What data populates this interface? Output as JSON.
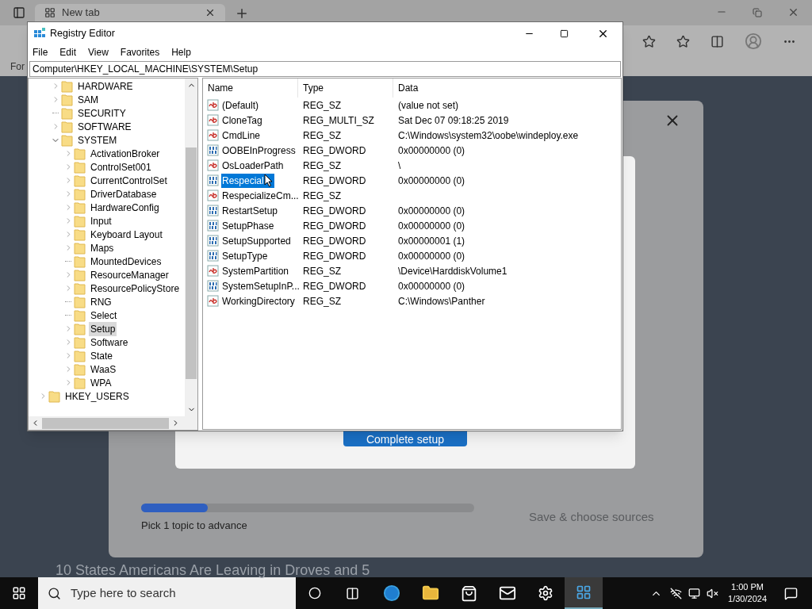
{
  "browser": {
    "tab_title": "New tab",
    "partial_text": "For"
  },
  "setup_dialog": {
    "complete_button": "Complete setup",
    "progress": {
      "level": 0.2
    },
    "hint": "Pick 1 topic to advance",
    "save_button": {
      "label": "Save & choose sources",
      "disabled": true
    }
  },
  "headline": "10 States Americans Are Leaving in Droves and 5",
  "registry": {
    "title": "Registry Editor",
    "menu": [
      "File",
      "Edit",
      "View",
      "Favorites",
      "Help"
    ],
    "address": "Computer\\HKEY_LOCAL_MACHINE\\SYSTEM\\Setup",
    "tree": [
      {
        "children": [
          {
            "kind": "collapsed",
            "name": "HARDWARE",
            "selected": false
          },
          {
            "kind": "collapsed",
            "name": "SAM",
            "selected": false
          },
          {
            "kind": "leaf",
            "name": "SECURITY",
            "selected": false
          },
          {
            "kind": "collapsed",
            "name": "SOFTWARE",
            "selected": false
          },
          {
            "kind": "expanded",
            "name": "SYSTEM",
            "selected": false,
            "children": [
              {
                "kind": "collapsed",
                "name": "ActivationBroker",
                "selected": false
              },
              {
                "kind": "collapsed",
                "name": "ControlSet001",
                "selected": false
              },
              {
                "kind": "collapsed",
                "name": "CurrentControlSet",
                "selected": false
              },
              {
                "kind": "collapsed",
                "name": "DriverDatabase",
                "selected": false
              },
              {
                "kind": "collapsed",
                "name": "HardwareConfig",
                "selected": false
              },
              {
                "kind": "collapsed",
                "name": "Input",
                "selected": false
              },
              {
                "kind": "collapsed",
                "name": "Keyboard Layout",
                "selected": false
              },
              {
                "kind": "collapsed",
                "name": "Maps",
                "selected": false
              },
              {
                "kind": "leaf",
                "name": "MountedDevices",
                "selected": false
              },
              {
                "kind": "collapsed",
                "name": "ResourceManager",
                "selected": false
              },
              {
                "kind": "collapsed",
                "name": "ResourcePolicyStore",
                "selected": false
              },
              {
                "kind": "leaf",
                "name": "RNG",
                "selected": false
              },
              {
                "kind": "leaf",
                "name": "Select",
                "selected": false
              },
              {
                "kind": "collapsed",
                "name": "Setup",
                "selected": true
              },
              {
                "kind": "collapsed",
                "name": "Software",
                "selected": false
              },
              {
                "kind": "collapsed",
                "name": "State",
                "selected": false
              },
              {
                "kind": "collapsed",
                "name": "WaaS",
                "selected": false
              },
              {
                "kind": "collapsed",
                "name": "WPA",
                "selected": false
              }
            ]
          }
        ]
      },
      {
        "kind": "collapsed",
        "name": "HKEY_USERS",
        "selected": false
      }
    ],
    "columns": [
      "Name",
      "Type",
      "Data"
    ],
    "values": [
      {
        "kind": "string",
        "name": "(Default)",
        "type": "REG_SZ",
        "data": "(value not set)",
        "selected": false
      },
      {
        "kind": "string",
        "name": "CloneTag",
        "type": "REG_MULTI_SZ",
        "data": "Sat Dec 07 09:18:25 2019",
        "selected": false
      },
      {
        "kind": "string",
        "name": "CmdLine",
        "type": "REG_SZ",
        "data": "C:\\Windows\\system32\\oobe\\windeploy.exe",
        "selected": false
      },
      {
        "kind": "binary",
        "name": "OOBEInProgress",
        "type": "REG_DWORD",
        "data": "0x00000000 (0)",
        "selected": false
      },
      {
        "kind": "string",
        "name": "OsLoaderPath",
        "type": "REG_SZ",
        "data": "\\",
        "selected": false
      },
      {
        "kind": "binary",
        "name": "Respecial",
        "type": "REG_DWORD",
        "data": "0x00000000 (0)",
        "selected": true
      },
      {
        "kind": "string",
        "name": "RespecializeCm...",
        "type": "REG_SZ",
        "selected": false
      },
      {
        "kind": "binary",
        "name": "RestartSetup",
        "type": "REG_DWORD",
        "data": "0x00000000 (0)",
        "selected": false
      },
      {
        "kind": "binary",
        "name": "SetupPhase",
        "type": "REG_DWORD",
        "data": "0x00000000 (0)",
        "selected": false
      },
      {
        "kind": "binary",
        "name": "SetupSupported",
        "type": "REG_DWORD",
        "data": "0x00000001 (1)",
        "selected": false
      },
      {
        "kind": "binary",
        "name": "SetupType",
        "type": "REG_DWORD",
        "data": "0x00000000 (0)",
        "selected": false
      },
      {
        "kind": "string",
        "name": "SystemPartition",
        "type": "REG_SZ",
        "data": "\\Device\\HarddiskVolume1",
        "selected": false
      },
      {
        "kind": "binary",
        "name": "SystemSetupInP...",
        "type": "REG_DWORD",
        "data": "0x00000000 (0)",
        "selected": false
      },
      {
        "kind": "string",
        "name": "WorkingDirectory",
        "type": "REG_SZ",
        "data": "C:\\Windows\\Panther",
        "selected": false
      }
    ]
  },
  "taskbar": {
    "search_placeholder": "Type here to search",
    "time": "1:00 PM",
    "date": "1/30/2024"
  }
}
